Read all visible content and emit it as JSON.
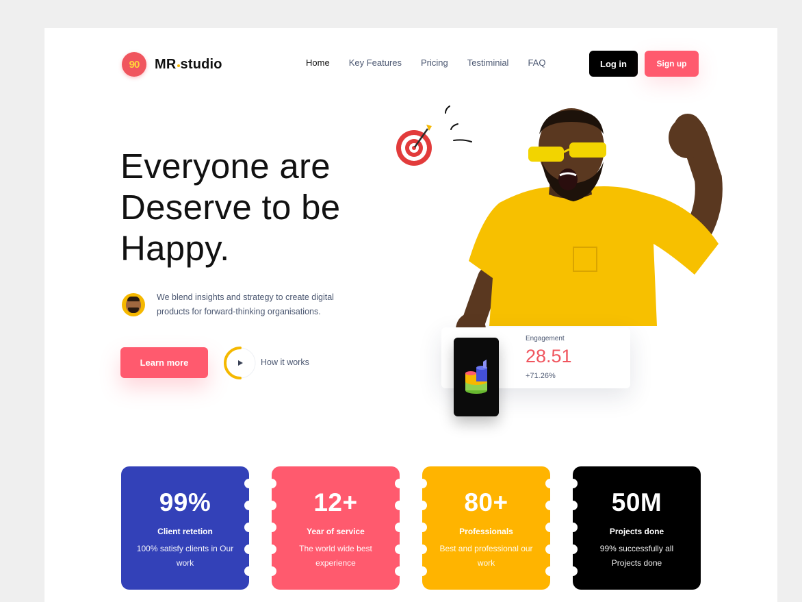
{
  "brand": {
    "logo_mark": "90",
    "name_part1": "MR",
    "name_part2": "studio",
    "accent": "#ff5a6e",
    "yellow": "#f5b800"
  },
  "nav": {
    "items": [
      "Home",
      "Key Features",
      "Pricing",
      "Testiminial",
      "FAQ"
    ]
  },
  "auth": {
    "login": "Log in",
    "signup": "Sign up"
  },
  "hero": {
    "title": "Everyone are Deserve to be Happy.",
    "description": "We blend insights and strategy to create digital products for forward-thinking organisations.",
    "learn_more": "Learn more",
    "how_it_works": "How it works"
  },
  "engagement": {
    "label": "Engagement",
    "value": "28.51",
    "change": "+71.26%"
  },
  "stats": [
    {
      "number": "99%",
      "label": "Client retetion",
      "sub": "100% satisfy clients in Our work",
      "color": "#3341b8"
    },
    {
      "number": "12+",
      "label": "Year of service",
      "sub": "The world wide best experience",
      "color": "#ff5a6e"
    },
    {
      "number": "80+",
      "label": "Professionals",
      "sub": "Best and professional our work",
      "color": "#ffb400"
    },
    {
      "number": "50M",
      "label": "Projects done",
      "sub": "99% successfully all Projects done",
      "color": "#000000"
    }
  ]
}
